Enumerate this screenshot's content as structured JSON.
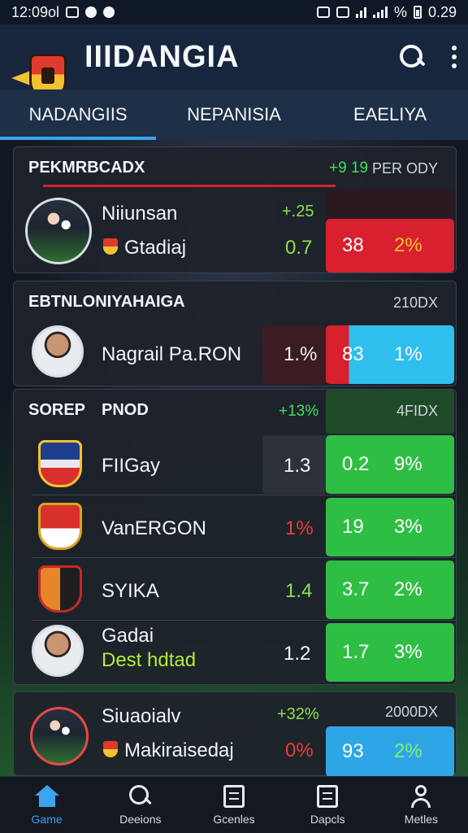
{
  "status_bar": {
    "time": "12:09ol",
    "battery_text": "% ",
    "clock_right": "0.29"
  },
  "app_bar": {
    "title": "IIIDANGIA",
    "logo_icon": "club-crest-logo",
    "actions": [
      "search-icon",
      "more-vert-icon"
    ]
  },
  "tabs": [
    {
      "label": "NADANGIIS",
      "active": true
    },
    {
      "label": "NEPANISIA",
      "active": false
    },
    {
      "label": "EAELIYA",
      "active": false
    }
  ],
  "cards": [
    {
      "title": "PEKMRBCADX",
      "change": "+9 19",
      "period": "PER ODY",
      "rows": [
        {
          "name": "Niiunsan",
          "sub": "Gtadiaj",
          "change": "+.25",
          "stat": "0.7",
          "box_v1": "38",
          "box_v2": "2%"
        }
      ]
    },
    {
      "title": "EBTNLONIYAHAIGA",
      "period": "210DX",
      "rows": [
        {
          "name": "Nagrail Pa.RON",
          "stat": "1.%",
          "box_v1": "83",
          "box_v2": "1%"
        }
      ]
    },
    {
      "title": "SOREP",
      "title_b": "PNOD",
      "change": "+13%",
      "period": "4FIDX",
      "rows": [
        {
          "name": "FIIGay",
          "stat": "1.3",
          "box_v1": "0.2",
          "box_v2": "9%"
        },
        {
          "name": "VanERGON",
          "stat": "1%",
          "box_v1": "19",
          "box_v2": "3%"
        },
        {
          "name": "SYIKA",
          "stat": "1.4",
          "box_v1": "3.7",
          "box_v2": "2%"
        },
        {
          "name": "Gadai",
          "sub": "Dest hdtad",
          "stat": "1.2",
          "box_v1": "1.7",
          "box_v2": "3%"
        }
      ]
    },
    {
      "rows": [
        {
          "name": "Siuaoialv",
          "sub": "Makiraisedaj",
          "change": "+32%",
          "period": "2000DX",
          "stat": "0%",
          "box_v1": "93",
          "box_v2": "2%"
        }
      ]
    }
  ],
  "bottom_nav": [
    {
      "label": "Game",
      "icon": "home-icon",
      "active": true
    },
    {
      "label": "Deeions",
      "icon": "search-icon",
      "active": false
    },
    {
      "label": "Gcenles",
      "icon": "list-icon",
      "active": false
    },
    {
      "label": "Dapcls",
      "icon": "document-icon",
      "active": false
    },
    {
      "label": "Metles",
      "icon": "profile-icon",
      "active": false
    }
  ],
  "colors": {
    "accent": "#3ba4ee",
    "positive": "#2fbe44",
    "negative": "#d8202e",
    "info": "#2ea6e6"
  }
}
